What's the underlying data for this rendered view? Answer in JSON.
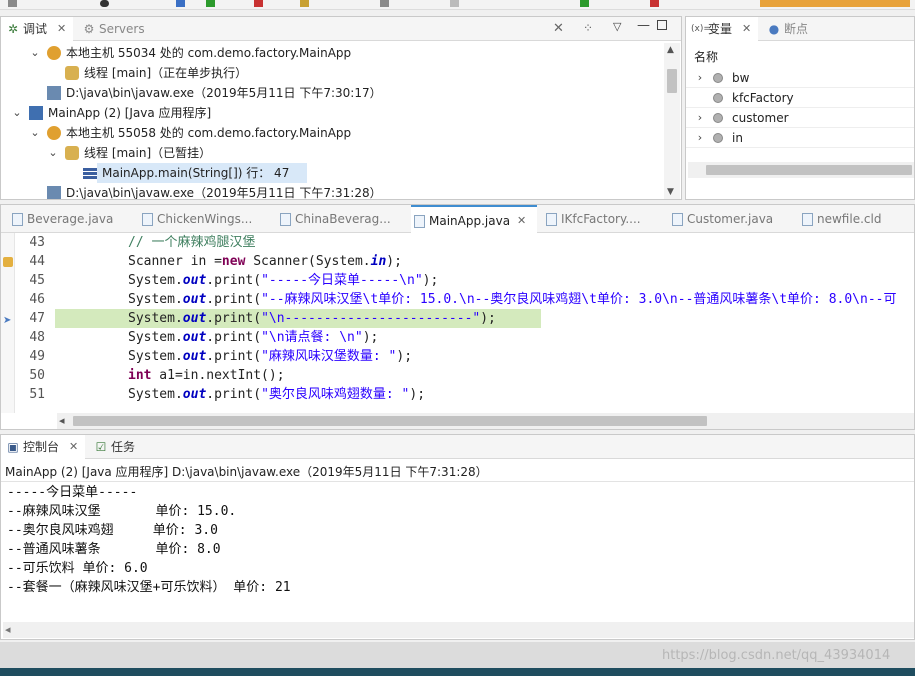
{
  "debug_view": {
    "tabs": [
      {
        "label": "调试",
        "active": true
      },
      {
        "label": "Servers",
        "active": false
      }
    ],
    "tree": [
      {
        "level": 1,
        "expanded": true,
        "icon": "launch-host-icon",
        "label": "本地主机 55034 处的 com.demo.factory.MainApp"
      },
      {
        "level": 2,
        "expanded": null,
        "icon": "thread-running-icon",
        "label": "线程 [main]（正在单步执行）"
      },
      {
        "level": 1,
        "expanded": null,
        "icon": "process-icon",
        "label": "D:\\java\\bin\\javaw.exe（2019年5月11日 下午7:30:17）"
      },
      {
        "level": 0,
        "expanded": true,
        "icon": "java-app-icon",
        "label": "MainApp (2) [Java 应用程序]"
      },
      {
        "level": 1,
        "expanded": true,
        "icon": "launch-host-icon",
        "label": "本地主机 55058 处的 com.demo.factory.MainApp"
      },
      {
        "level": 2,
        "expanded": true,
        "icon": "thread-suspended-icon",
        "label": "线程 [main]（已暂挂）"
      },
      {
        "level": 3,
        "expanded": null,
        "icon": "stack-frame-icon",
        "label": "MainApp.main(String[]) 行： 47",
        "selected": true
      },
      {
        "level": 1,
        "expanded": null,
        "icon": "process-icon",
        "label": "D:\\java\\bin\\javaw.exe（2019年5月11日 下午7:31:28）"
      }
    ]
  },
  "variables_view": {
    "tabs": [
      {
        "label": "变量",
        "active": true
      },
      {
        "label": "断点",
        "active": false
      }
    ],
    "column_header": "名称",
    "items": [
      {
        "name": "bw",
        "expandable": true
      },
      {
        "name": "kfcFactory",
        "expandable": false
      },
      {
        "name": "customer",
        "expandable": true
      },
      {
        "name": "in",
        "expandable": true
      }
    ]
  },
  "editor": {
    "tabs": [
      {
        "label": "Beverage.java",
        "active": false
      },
      {
        "label": "ChickenWings...",
        "active": false
      },
      {
        "label": "ChinaBeverag...",
        "active": false
      },
      {
        "label": "MainApp.java",
        "active": true
      },
      {
        "label": "IKfcFactory....",
        "active": false
      },
      {
        "label": "Customer.java",
        "active": false
      },
      {
        "label": "newfile.cld",
        "active": false
      }
    ],
    "current_line": 47,
    "lines": [
      {
        "n": "43",
        "parts": [
          [
            "cm",
            "// 一个麻辣鸡腿汉堡"
          ]
        ]
      },
      {
        "n": "44",
        "parts": [
          [
            "",
            "Scanner in ="
          ],
          [
            "kw",
            "new"
          ],
          [
            "",
            " Scanner(System."
          ],
          [
            "fld",
            "in"
          ],
          [
            "",
            ");"
          ]
        ]
      },
      {
        "n": "45",
        "parts": [
          [
            "",
            "System."
          ],
          [
            "fld",
            "out"
          ],
          [
            "",
            ".print("
          ],
          [
            "st",
            "\"-----今日菜单-----\\n\""
          ],
          [
            "",
            ");"
          ]
        ]
      },
      {
        "n": "46",
        "parts": [
          [
            "",
            "System."
          ],
          [
            "fld",
            "out"
          ],
          [
            "",
            ".print("
          ],
          [
            "st",
            "\"--麻辣风味汉堡\\t单价: 15.0.\\n--奥尔良风味鸡翅\\t单价: 3.0\\n--普通风味薯条\\t单价: 8.0\\n--可"
          ]
        ]
      },
      {
        "n": "47",
        "parts": [
          [
            "",
            "System."
          ],
          [
            "fld",
            "out"
          ],
          [
            "",
            ".print("
          ],
          [
            "st",
            "\"\\n------------------------\""
          ],
          [
            "",
            ");"
          ]
        ]
      },
      {
        "n": "48",
        "parts": [
          [
            "",
            "System."
          ],
          [
            "fld",
            "out"
          ],
          [
            "",
            ".print("
          ],
          [
            "st",
            "\"\\n请点餐: \\n\""
          ],
          [
            "",
            ");"
          ]
        ]
      },
      {
        "n": "49",
        "parts": [
          [
            "",
            "System."
          ],
          [
            "fld",
            "out"
          ],
          [
            "",
            ".print("
          ],
          [
            "st",
            "\"麻辣风味汉堡数量: \""
          ],
          [
            "",
            ");"
          ]
        ]
      },
      {
        "n": "50",
        "parts": [
          [
            "kw",
            "int"
          ],
          [
            "",
            " a1=in.nextInt();"
          ]
        ]
      },
      {
        "n": "51",
        "parts": [
          [
            "",
            "System."
          ],
          [
            "fld",
            "out"
          ],
          [
            "",
            ".print("
          ],
          [
            "st",
            "\"奥尔良风味鸡翅数量: \""
          ],
          [
            "",
            ");"
          ]
        ]
      }
    ]
  },
  "console_view": {
    "tabs": [
      {
        "label": "控制台",
        "active": true
      },
      {
        "label": "任务",
        "active": false
      }
    ],
    "process_label": "MainApp (2) [Java 应用程序] D:\\java\\bin\\javaw.exe（2019年5月11日 下午7:31:28）",
    "output": [
      "-----今日菜单-----",
      "--麻辣风味汉堡       单价: 15.0.",
      "--奥尔良风味鸡翅     单价: 3.0",
      "--普通风味薯条       单价: 8.0",
      "--可乐饮料 单价: 6.0",
      "--套餐一（麻辣风味汉堡+可乐饮料） 单价: 21"
    ]
  },
  "watermark": "https://blog.csdn.net/qq_43934014",
  "colors": {
    "accent": "#3f8dd0",
    "current_line": "#d4eabd",
    "keyword": "#7f0055",
    "string": "#2a00ff",
    "field": "#0000c0",
    "comment": "#3f7f5f"
  }
}
